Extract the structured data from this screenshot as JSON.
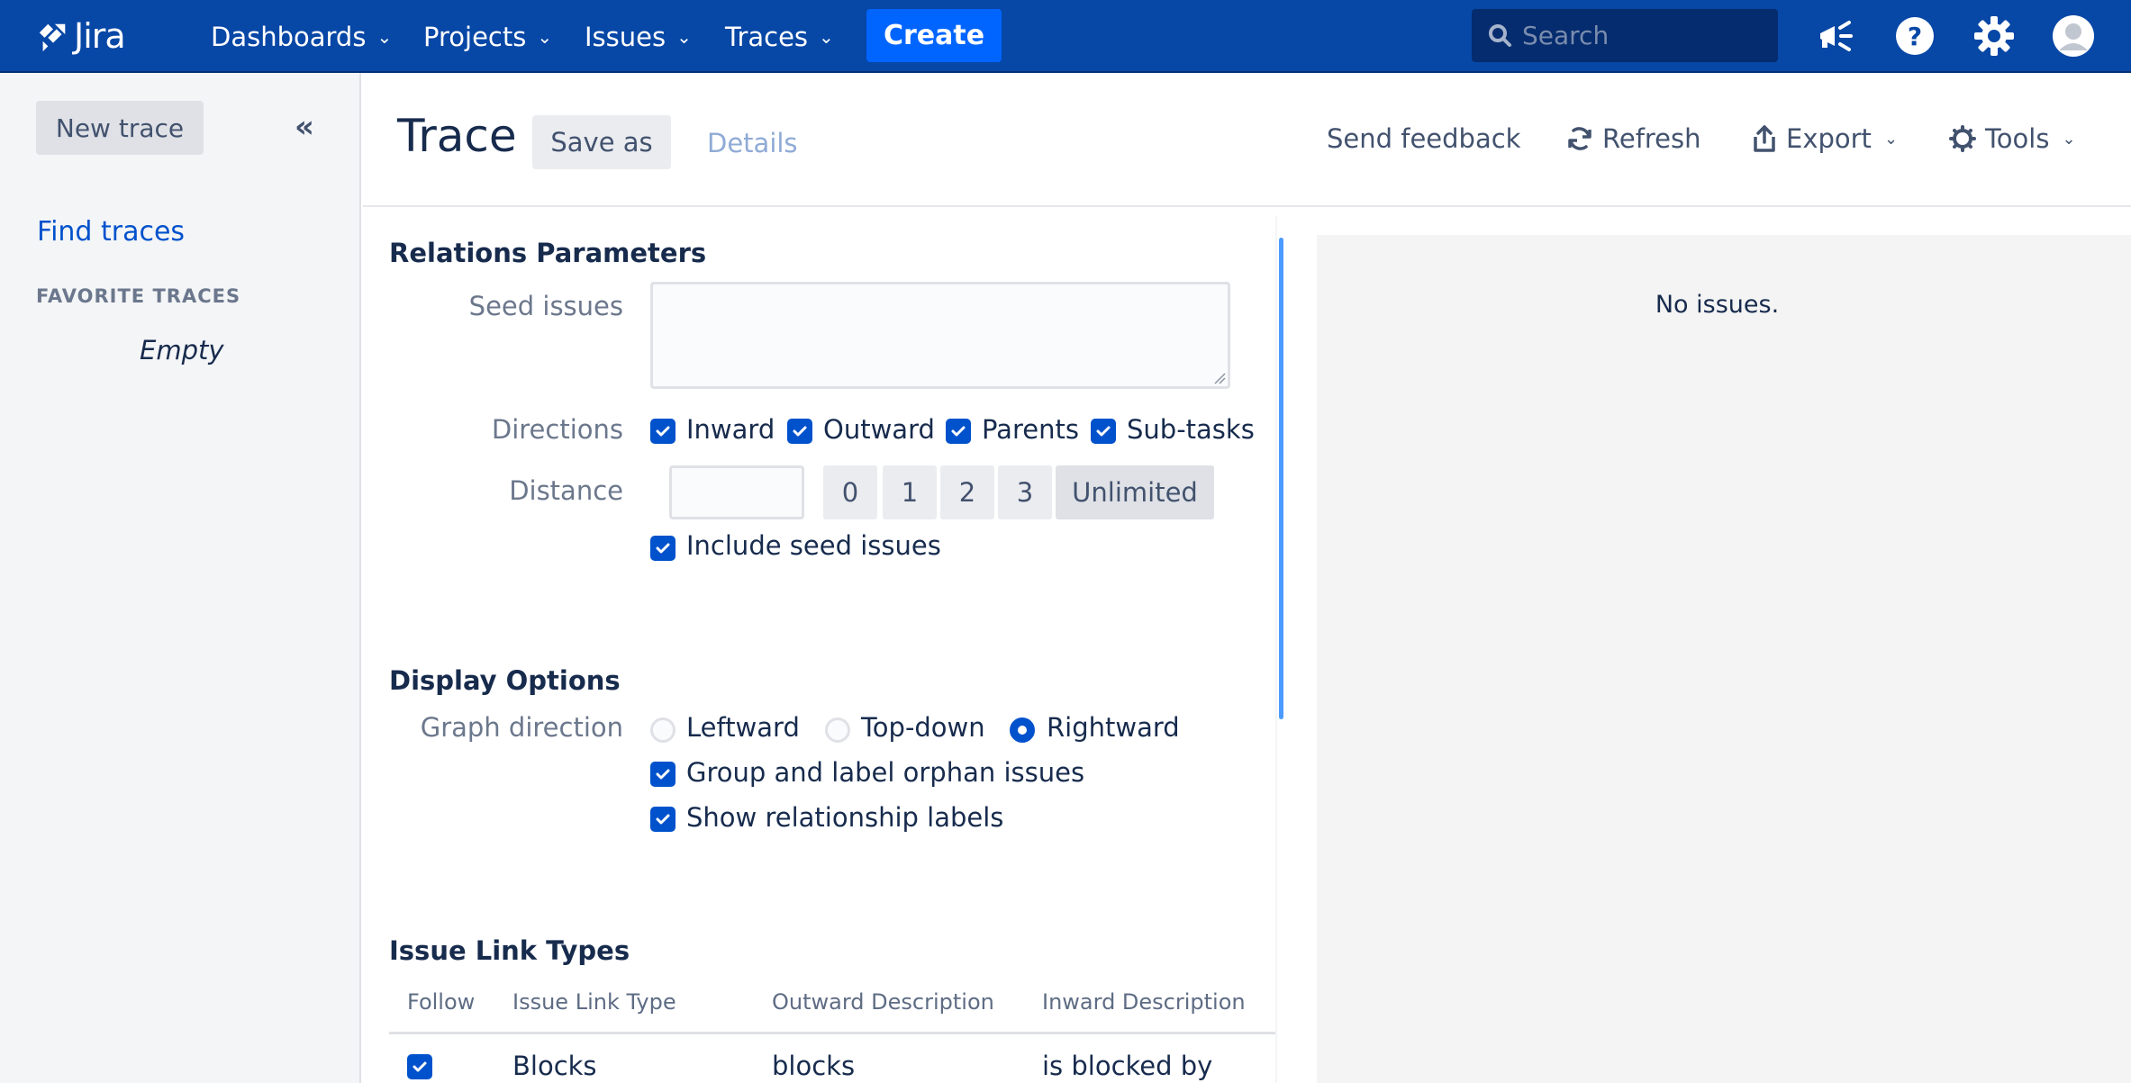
{
  "app": {
    "name": "Jira"
  },
  "topnav": {
    "menus": [
      {
        "label": "Dashboards"
      },
      {
        "label": "Projects"
      },
      {
        "label": "Issues"
      },
      {
        "label": "Traces"
      }
    ],
    "create_label": "Create",
    "search_placeholder": "Search",
    "icons": [
      "megaphone-icon",
      "help-icon",
      "settings-gear-icon",
      "user-avatar-icon"
    ],
    "colors": {
      "bar": "#0747a6",
      "create": "#0065ff"
    }
  },
  "sidebar": {
    "new_trace_label": "New trace",
    "collapse_glyph": "«",
    "find_traces_label": "Find traces",
    "favorites_heading": "FAVORITE TRACES",
    "favorites_empty": "Empty"
  },
  "header": {
    "title": "Trace",
    "save_as_label": "Save as",
    "details_label": "Details",
    "actions": [
      {
        "label": "Send feedback",
        "icon": null
      },
      {
        "label": "Refresh",
        "icon": "refresh-icon"
      },
      {
        "label": "Export",
        "icon": "export-icon"
      },
      {
        "label": "Tools",
        "icon": "gear-icon"
      }
    ]
  },
  "relations": {
    "title": "Relations Parameters",
    "seed_issues_label": "Seed issues",
    "seed_issues_value": "",
    "directions_label": "Directions",
    "directions": [
      {
        "label": "Inward",
        "checked": true
      },
      {
        "label": "Outward",
        "checked": true
      },
      {
        "label": "Parents",
        "checked": true
      },
      {
        "label": "Sub-tasks",
        "checked": true
      }
    ],
    "distance_label": "Distance",
    "distance_value": "",
    "distance_options": [
      "0",
      "1",
      "2",
      "3",
      "Unlimited"
    ],
    "distance_selected": "Unlimited",
    "include_seed_label": "Include seed issues",
    "include_seed_checked": true
  },
  "display": {
    "title": "Display Options",
    "graph_direction_label": "Graph direction",
    "graph_directions": [
      {
        "label": "Leftward",
        "selected": false
      },
      {
        "label": "Top-down",
        "selected": false
      },
      {
        "label": "Rightward",
        "selected": true
      }
    ],
    "group_orphans_label": "Group and label orphan issues",
    "group_orphans_checked": true,
    "show_rel_labels_label": "Show relationship labels",
    "show_rel_labels_checked": true
  },
  "link_types": {
    "title": "Issue Link Types",
    "columns": [
      "Follow",
      "Issue Link Type",
      "Outward Description",
      "Inward Description"
    ],
    "rows": [
      {
        "follow": true,
        "type": "Blocks",
        "outward": "blocks",
        "inward": "is blocked by"
      }
    ]
  },
  "results": {
    "empty_message": "No issues."
  }
}
